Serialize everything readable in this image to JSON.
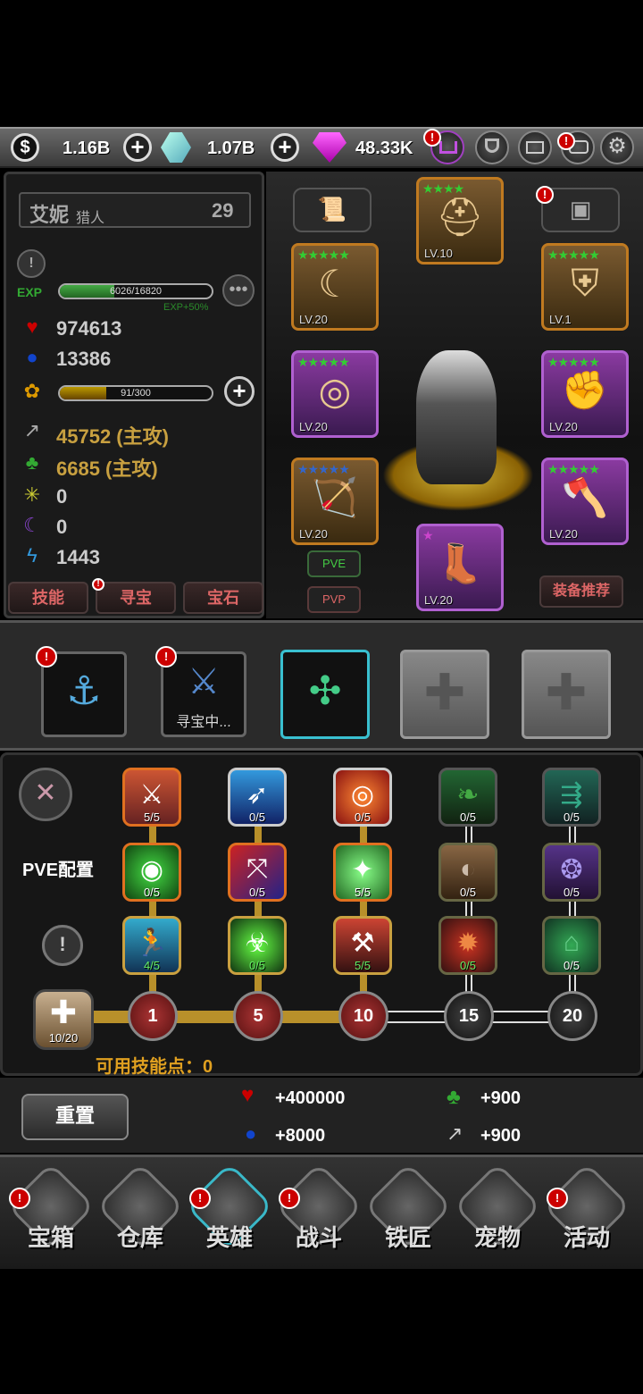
{
  "currency": {
    "gold": "1.16B",
    "crystal": "1.07B",
    "gem": "48.33K"
  },
  "hero": {
    "name": "艾妮",
    "class": "猎人",
    "level": "29",
    "exp_label": "EXP",
    "exp_text": "6026/16820",
    "exp_progress": 0.358,
    "exp_bonus": "EXP+50%",
    "hp": "974613",
    "mp": "13386",
    "pet_text": "91/300",
    "pet_progress": 0.303,
    "attack": "45752 (主攻)",
    "agility": "6685 (主攻)",
    "stat_light": "0",
    "stat_dark": "0",
    "speed": "1443"
  },
  "hero_tabs": [
    "技能",
    "寻宝",
    "宝石"
  ],
  "equipment": {
    "slots": [
      {
        "lv": "LV.10",
        "stars": "★★★★",
        "glyph": "⛑"
      },
      {
        "lv": "LV.20",
        "stars": "★★★★★",
        "glyph": "☾"
      },
      {
        "lv": "LV.1",
        "stars": "★★★★★",
        "glyph": "⛨"
      },
      {
        "lv": "LV.20",
        "stars": "★★★★★",
        "glyph": "◎"
      },
      {
        "lv": "LV.20",
        "stars": "★★★★★",
        "glyph": "✊"
      },
      {
        "lv": "LV.20",
        "stars": "★★★★★",
        "glyph": "🏹"
      },
      {
        "lv": "LV.20",
        "stars": "★★★★★",
        "glyph": "🪓"
      },
      {
        "lv": "LV.20",
        "stars": "★",
        "glyph": "👢"
      }
    ],
    "pve_label": "PVE",
    "pvp_label": "PVP",
    "recommend_label": "装备推荐"
  },
  "skill_sets": {
    "searching_label": "寻宝中..."
  },
  "skill_tree": {
    "config_label": "PVE配置",
    "rows": [
      [
        "5/5",
        "0/5",
        "0/5",
        "0/5",
        "0/5"
      ],
      [
        "0/5",
        "0/5",
        "5/5",
        "0/5",
        "0/5"
      ],
      [
        "4/5",
        "0/5",
        "5/5",
        "0/5",
        "0/5"
      ]
    ],
    "tiers": [
      "1",
      "5",
      "10",
      "15",
      "20"
    ],
    "points_badge": "10/20",
    "available_points": "可用技能点：0"
  },
  "bonus": {
    "reset_label": "重置",
    "hp": "+400000",
    "mp": "+8000",
    "agility": "+900",
    "attack": "+900"
  },
  "nav": [
    "宝箱",
    "仓库",
    "英雄",
    "战斗",
    "铁匠",
    "宠物",
    "活动"
  ],
  "colors": {
    "accent": "#3ab8c8",
    "gold_text": "#e0a020",
    "alert": "#cc0000"
  }
}
